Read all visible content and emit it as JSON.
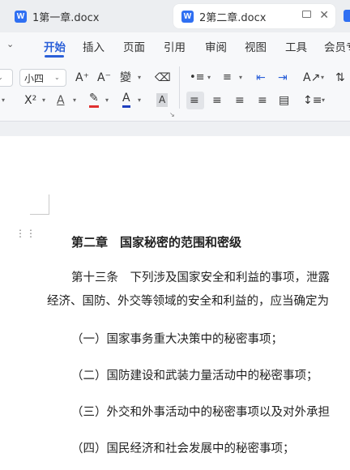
{
  "tabs": [
    {
      "icon_letter": "W",
      "label": "1第一章.docx"
    },
    {
      "icon_letter": "W",
      "label": "2第二章.docx",
      "close_glyph": "✕"
    }
  ],
  "menu": {
    "items": [
      "开始",
      "插入",
      "页面",
      "引用",
      "审阅",
      "视图",
      "工具",
      "会员专"
    ],
    "active": "开始"
  },
  "toolbar": {
    "font_size": "小四",
    "grow_font": "A⁺",
    "shrink_font": "A⁻",
    "phonetic": "變",
    "eraser": "⌫",
    "superscript": "X²",
    "text_effect": "A",
    "highlight": "✎",
    "font_color": "A",
    "char_shading": "A"
  },
  "colors": {
    "accent": "#2a5fd8",
    "word_icon": "#2f6ff2",
    "font_color_bar": "#1f3fbf",
    "highlight_bar": "#e03030"
  },
  "document": {
    "heading": "第二章　国家秘密的范围和密级",
    "paragraphs": [
      "第十三条　下列涉及国家安全和利益的事项，泄露",
      "经济、国防、外交等领域的安全和利益的，应当确定为",
      "（一）国家事务重大决策中的秘密事项；",
      "（二）国防建设和武装力量活动中的秘密事项；",
      "（三）外交和外事活动中的秘密事项以及对外承担",
      "（四）国民经济和社会发展中的秘密事项；"
    ]
  }
}
